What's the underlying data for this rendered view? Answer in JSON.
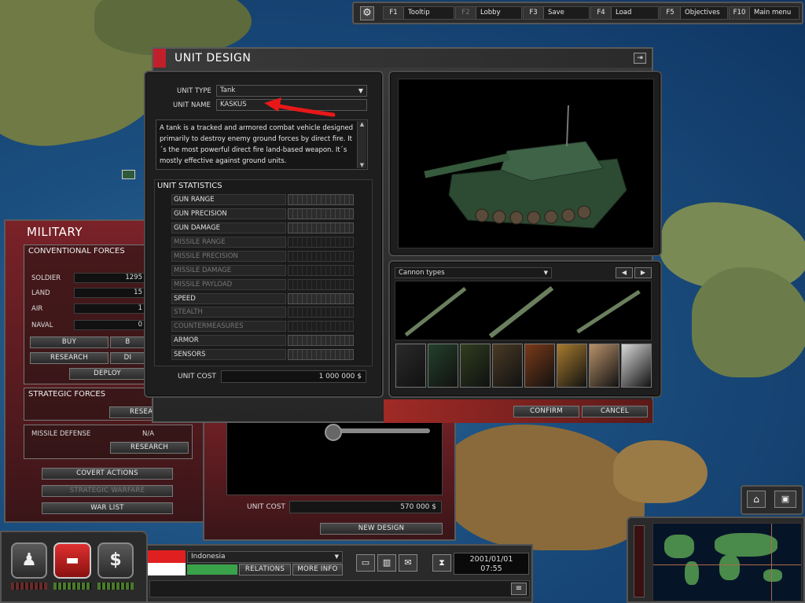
{
  "toolbar": {
    "items": [
      {
        "key": "F1",
        "label": "Tooltip"
      },
      {
        "key": "F2",
        "label": "Lobby"
      },
      {
        "key": "F3",
        "label": "Save"
      },
      {
        "key": "F4",
        "label": "Load"
      },
      {
        "key": "F5",
        "label": "Objectives"
      },
      {
        "key": "F10",
        "label": "Main menu"
      }
    ]
  },
  "unit_design": {
    "title": "UNIT DESIGN",
    "unit_type_label": "UNIT TYPE",
    "unit_type_value": "Tank",
    "unit_name_label": "UNIT NAME",
    "unit_name_value": "KASKUS",
    "description": "A tank is a tracked and armored combat vehicle designed primarily to destroy enemy ground forces by direct fire. It´s the most powerful direct fire land-based weapon. It´s mostly effective against ground units.",
    "stats_title": "UNIT STATISTICS",
    "stats": [
      {
        "label": "GUN RANGE",
        "enabled": true
      },
      {
        "label": "GUN PRECISION",
        "enabled": true
      },
      {
        "label": "GUN DAMAGE",
        "enabled": true
      },
      {
        "label": "MISSILE RANGE",
        "enabled": false
      },
      {
        "label": "MISSILE PRECISION",
        "enabled": false
      },
      {
        "label": "MISSILE DAMAGE",
        "enabled": false
      },
      {
        "label": "MISSILE PAYLOAD",
        "enabled": false
      },
      {
        "label": "SPEED",
        "enabled": true
      },
      {
        "label": "STEALTH",
        "enabled": false
      },
      {
        "label": "COUNTERMEASURES",
        "enabled": false
      },
      {
        "label": "ARMOR",
        "enabled": true
      },
      {
        "label": "SENSORS",
        "enabled": true
      }
    ],
    "unit_cost_label": "UNIT COST",
    "unit_cost_value": "1 000 000 $",
    "cannon_select": "Cannon types",
    "swatch_colors": [
      "#2a2a2a",
      "#23402a",
      "#2f3d1e",
      "#4a3a25",
      "#7a3a18",
      "#a77b2e",
      "#b8916a",
      "#d8d8d8"
    ],
    "confirm_label": "CONFIRM",
    "cancel_label": "CANCEL"
  },
  "military": {
    "title": "MILITARY",
    "conv_title": "CONVENTIONAL FORCES",
    "rows": [
      {
        "label": "SOLDIER",
        "value": "1295"
      },
      {
        "label": "LAND",
        "value": "15"
      },
      {
        "label": "AIR",
        "value": "1"
      },
      {
        "label": "NAVAL",
        "value": "0"
      }
    ],
    "buy_label": "BUY",
    "build_label": "B",
    "research_label": "RESEARCH",
    "disband_label": "DI",
    "deploy_label": "DEPLOY",
    "strategic_title": "STRATEGIC FORCES",
    "strategic_research": "RESEARCH",
    "missile_defense_label": "MISSILE DEFENSE",
    "missile_defense_value": "N/A",
    "md_research": "RESEARCH",
    "covert_actions": "COVERT ACTIONS",
    "strategic_warfare": "STRATEGIC WARFARE",
    "war_list": "WAR LIST"
  },
  "design_list": {
    "unit_cost_label": "UNIT COST",
    "unit_cost_value": "570 000 $",
    "new_design_label": "NEW DESIGN"
  },
  "bottom_bar": {
    "country": "Indonesia",
    "relations_label": "RELATIONS",
    "more_info_label": "MORE INFO",
    "date": "2001/01/01",
    "time": "07:55"
  }
}
